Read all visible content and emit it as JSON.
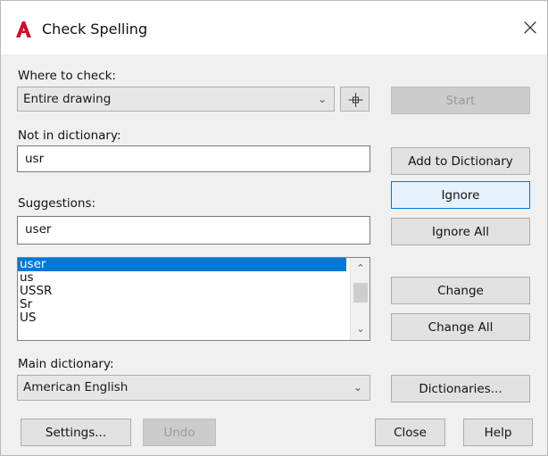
{
  "window": {
    "title": "Check Spelling",
    "close_glyph": "×"
  },
  "where_to_check": {
    "label": "Where to check:",
    "value": "Entire drawing"
  },
  "not_in_dictionary": {
    "label": "Not in dictionary:",
    "value": "usr"
  },
  "suggestions": {
    "label": "Suggestions:",
    "value": "user",
    "list": [
      "user",
      "us",
      "USSR",
      "Sr",
      "US"
    ],
    "selected": "user"
  },
  "main_dictionary": {
    "label": "Main dictionary:",
    "value": "American English"
  },
  "buttons": {
    "start": "Start",
    "add_to_dictionary": "Add to Dictionary",
    "ignore": "Ignore",
    "ignore_all": "Ignore All",
    "change": "Change",
    "change_all": "Change All",
    "dictionaries": "Dictionaries...",
    "settings": "Settings...",
    "undo": "Undo",
    "close": "Close",
    "help": "Help"
  },
  "icons": {
    "app": "autocad-logo-icon",
    "select_objects": "crosshair-icon",
    "dropdown": "chevron-down-icon"
  }
}
